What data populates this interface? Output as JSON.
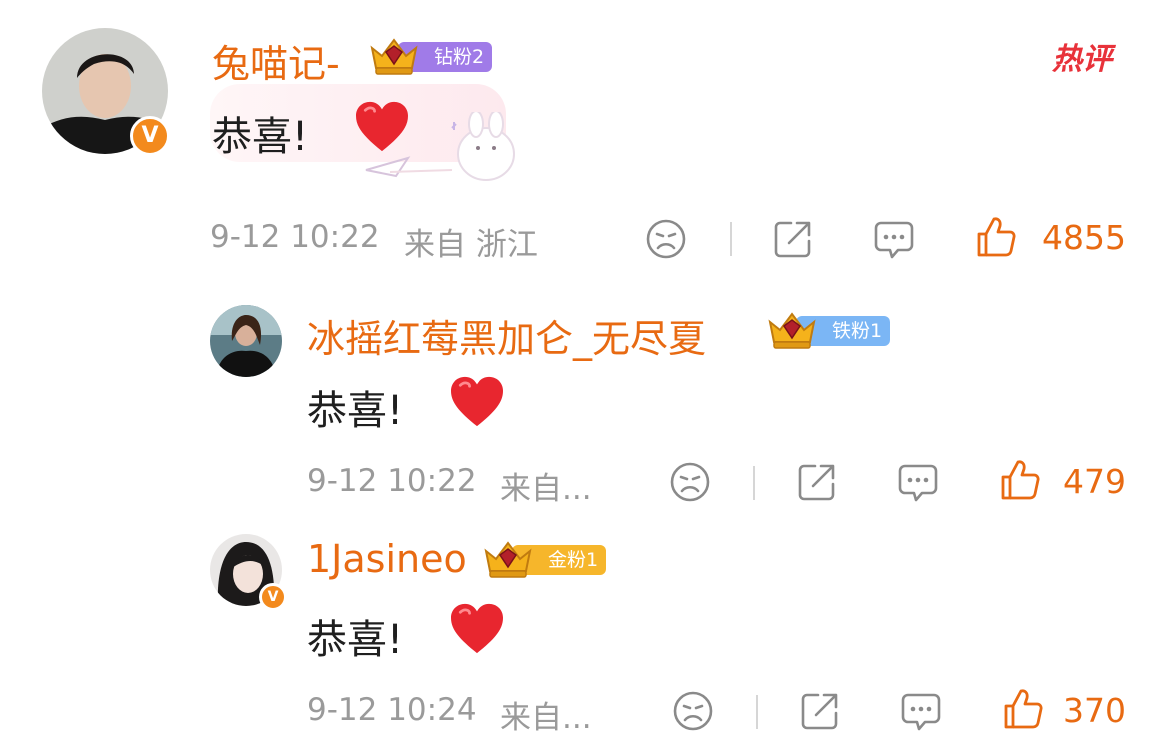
{
  "hot_tag": "热评",
  "colors": {
    "accent": "#e86a12",
    "meta": "#9a9a9a",
    "text": "#1f1f1f",
    "heart": "#e8262f"
  },
  "comments": [
    {
      "username": "兔喵记-",
      "badge": "钻粉2",
      "badge_color": "#a07be8",
      "verified": true,
      "text": "恭喜!",
      "emoji_icon": "heart-icon",
      "timestamp": "9-12 10:22",
      "location": "来自 浙江",
      "likes": "4855"
    },
    {
      "username": "冰摇红莓黑加仑_无尽夏",
      "badge": "铁粉1",
      "badge_color": "#7bb6f5",
      "verified": false,
      "text": "恭喜!",
      "emoji_icon": "heart-icon",
      "timestamp": "9-12 10:22",
      "location": "来自...",
      "likes": "479"
    },
    {
      "username": "1Jasineo",
      "badge": "金粉1",
      "badge_color": "#f6b62b",
      "verified": true,
      "text": "恭喜!",
      "emoji_icon": "heart-icon",
      "timestamp": "9-12 10:24",
      "location": "来自...",
      "likes": "370"
    }
  ]
}
